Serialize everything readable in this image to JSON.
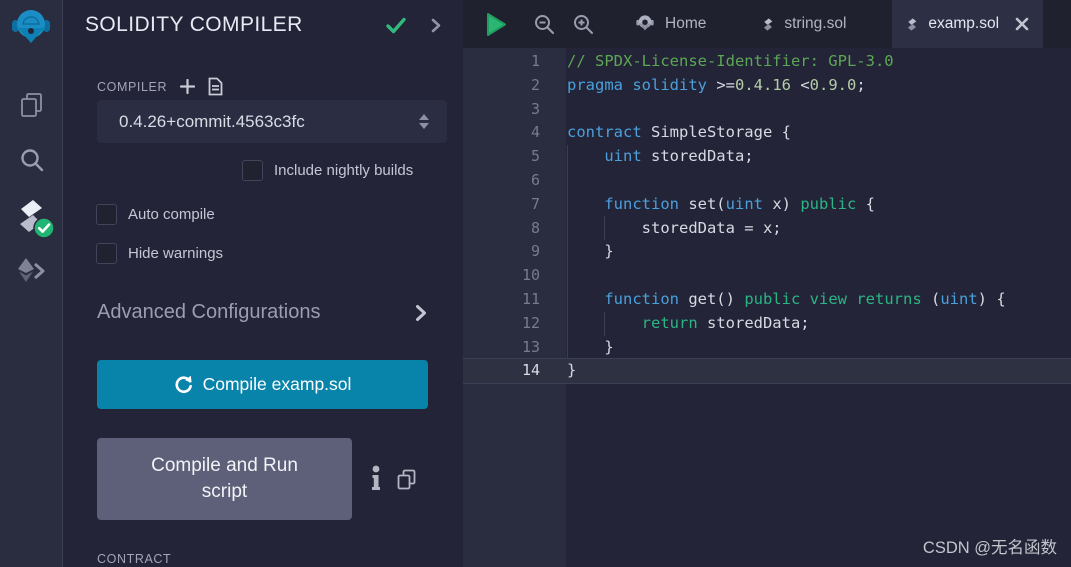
{
  "app": {
    "panel_title": "SOLIDITY COMPILER",
    "watermark": "CSDN @无名函数"
  },
  "sidebar_icons": [
    {
      "name": "remix-logo-icon"
    },
    {
      "name": "file-explorer-icon"
    },
    {
      "name": "search-icon"
    },
    {
      "name": "solidity-compiler-icon",
      "active": true,
      "badge": "success-check"
    },
    {
      "name": "deploy-run-icon"
    }
  ],
  "compiler_section": {
    "label": "COMPILER",
    "header_icons": [
      "add-compiler-icon",
      "file-doc-icon"
    ],
    "version": "0.4.26+commit.4563c3fc",
    "checkboxes": [
      {
        "label": "Include nightly builds",
        "checked": false
      },
      {
        "label": "Auto compile",
        "checked": false
      },
      {
        "label": "Hide warnings",
        "checked": false
      }
    ],
    "advanced_label": "Advanced Configurations",
    "compile_button": "Compile examp.sol",
    "compile_run_label_line1": "Compile and Run",
    "compile_run_label_line2": "script",
    "side_icons": [
      "info-icon",
      "copy-icon"
    ],
    "contract_label": "CONTRACT"
  },
  "tabbar": {
    "controls": [
      "run-icon",
      "zoom-out-icon",
      "zoom-in-icon"
    ],
    "tabs": [
      {
        "label": "Home",
        "icon": "remix",
        "active": false,
        "closable": false
      },
      {
        "label": "string.sol",
        "icon": "solidity",
        "active": false,
        "closable": false
      },
      {
        "label": "examp.sol",
        "icon": "solidity",
        "active": true,
        "closable": true
      }
    ]
  },
  "editor": {
    "current_line": 14,
    "lines": [
      {
        "n": 1,
        "tokens": [
          [
            "com",
            "// SPDX-License-Identifier: GPL-3.0"
          ]
        ]
      },
      {
        "n": 2,
        "tokens": [
          [
            "kw",
            "pragma"
          ],
          [
            "pl",
            " "
          ],
          [
            "kw",
            "solidity"
          ],
          [
            "pl",
            " >="
          ],
          [
            "num",
            "0.4.16"
          ],
          [
            "pl",
            " <"
          ],
          [
            "num",
            "0.9.0"
          ],
          [
            "pl",
            ";"
          ]
        ]
      },
      {
        "n": 3,
        "tokens": []
      },
      {
        "n": 4,
        "tokens": [
          [
            "kw",
            "contract"
          ],
          [
            "pl",
            " SimpleStorage {"
          ]
        ]
      },
      {
        "n": 5,
        "tokens": [
          [
            "pl",
            "    "
          ],
          [
            "kw",
            "uint"
          ],
          [
            "pl",
            " storedData;"
          ]
        ]
      },
      {
        "n": 6,
        "tokens": []
      },
      {
        "n": 7,
        "tokens": [
          [
            "pl",
            "    "
          ],
          [
            "kw",
            "function"
          ],
          [
            "pl",
            " set("
          ],
          [
            "kw",
            "uint"
          ],
          [
            "pl",
            " x) "
          ],
          [
            "kw2",
            "public"
          ],
          [
            "pl",
            " {"
          ]
        ]
      },
      {
        "n": 8,
        "tokens": [
          [
            "pl",
            "        storedData = x;"
          ]
        ]
      },
      {
        "n": 9,
        "tokens": [
          [
            "pl",
            "    }"
          ]
        ]
      },
      {
        "n": 10,
        "tokens": []
      },
      {
        "n": 11,
        "tokens": [
          [
            "pl",
            "    "
          ],
          [
            "kw",
            "function"
          ],
          [
            "pl",
            " get() "
          ],
          [
            "kw2",
            "public"
          ],
          [
            "pl",
            " "
          ],
          [
            "kw2",
            "view"
          ],
          [
            "pl",
            " "
          ],
          [
            "kw2",
            "returns"
          ],
          [
            "pl",
            " ("
          ],
          [
            "kw",
            "uint"
          ],
          [
            "pl",
            ") {"
          ]
        ]
      },
      {
        "n": 12,
        "tokens": [
          [
            "pl",
            "        "
          ],
          [
            "kw2",
            "return"
          ],
          [
            "pl",
            " storedData;"
          ]
        ]
      },
      {
        "n": 13,
        "tokens": [
          [
            "pl",
            "    }"
          ]
        ]
      },
      {
        "n": 14,
        "tokens": [
          [
            "pl",
            "}"
          ]
        ]
      }
    ]
  },
  "colors": {
    "accent_primary": "#0884ab",
    "secondary_button": "#5d6078",
    "success_green": "#32ba7c",
    "icon_panel_bg": "#2a2c3f",
    "panel_bg": "#232437",
    "editor_bg": "#232437",
    "gutter_bg": "#2a2c3f",
    "active_tab_bg": "#2d3044",
    "syntax_comment": "#5ca755",
    "syntax_keyword": "#4aa0db",
    "syntax_keyword2": "#2bb583",
    "syntax_number": "#b5cea8",
    "syntax_plain": "#d7d9e3"
  }
}
